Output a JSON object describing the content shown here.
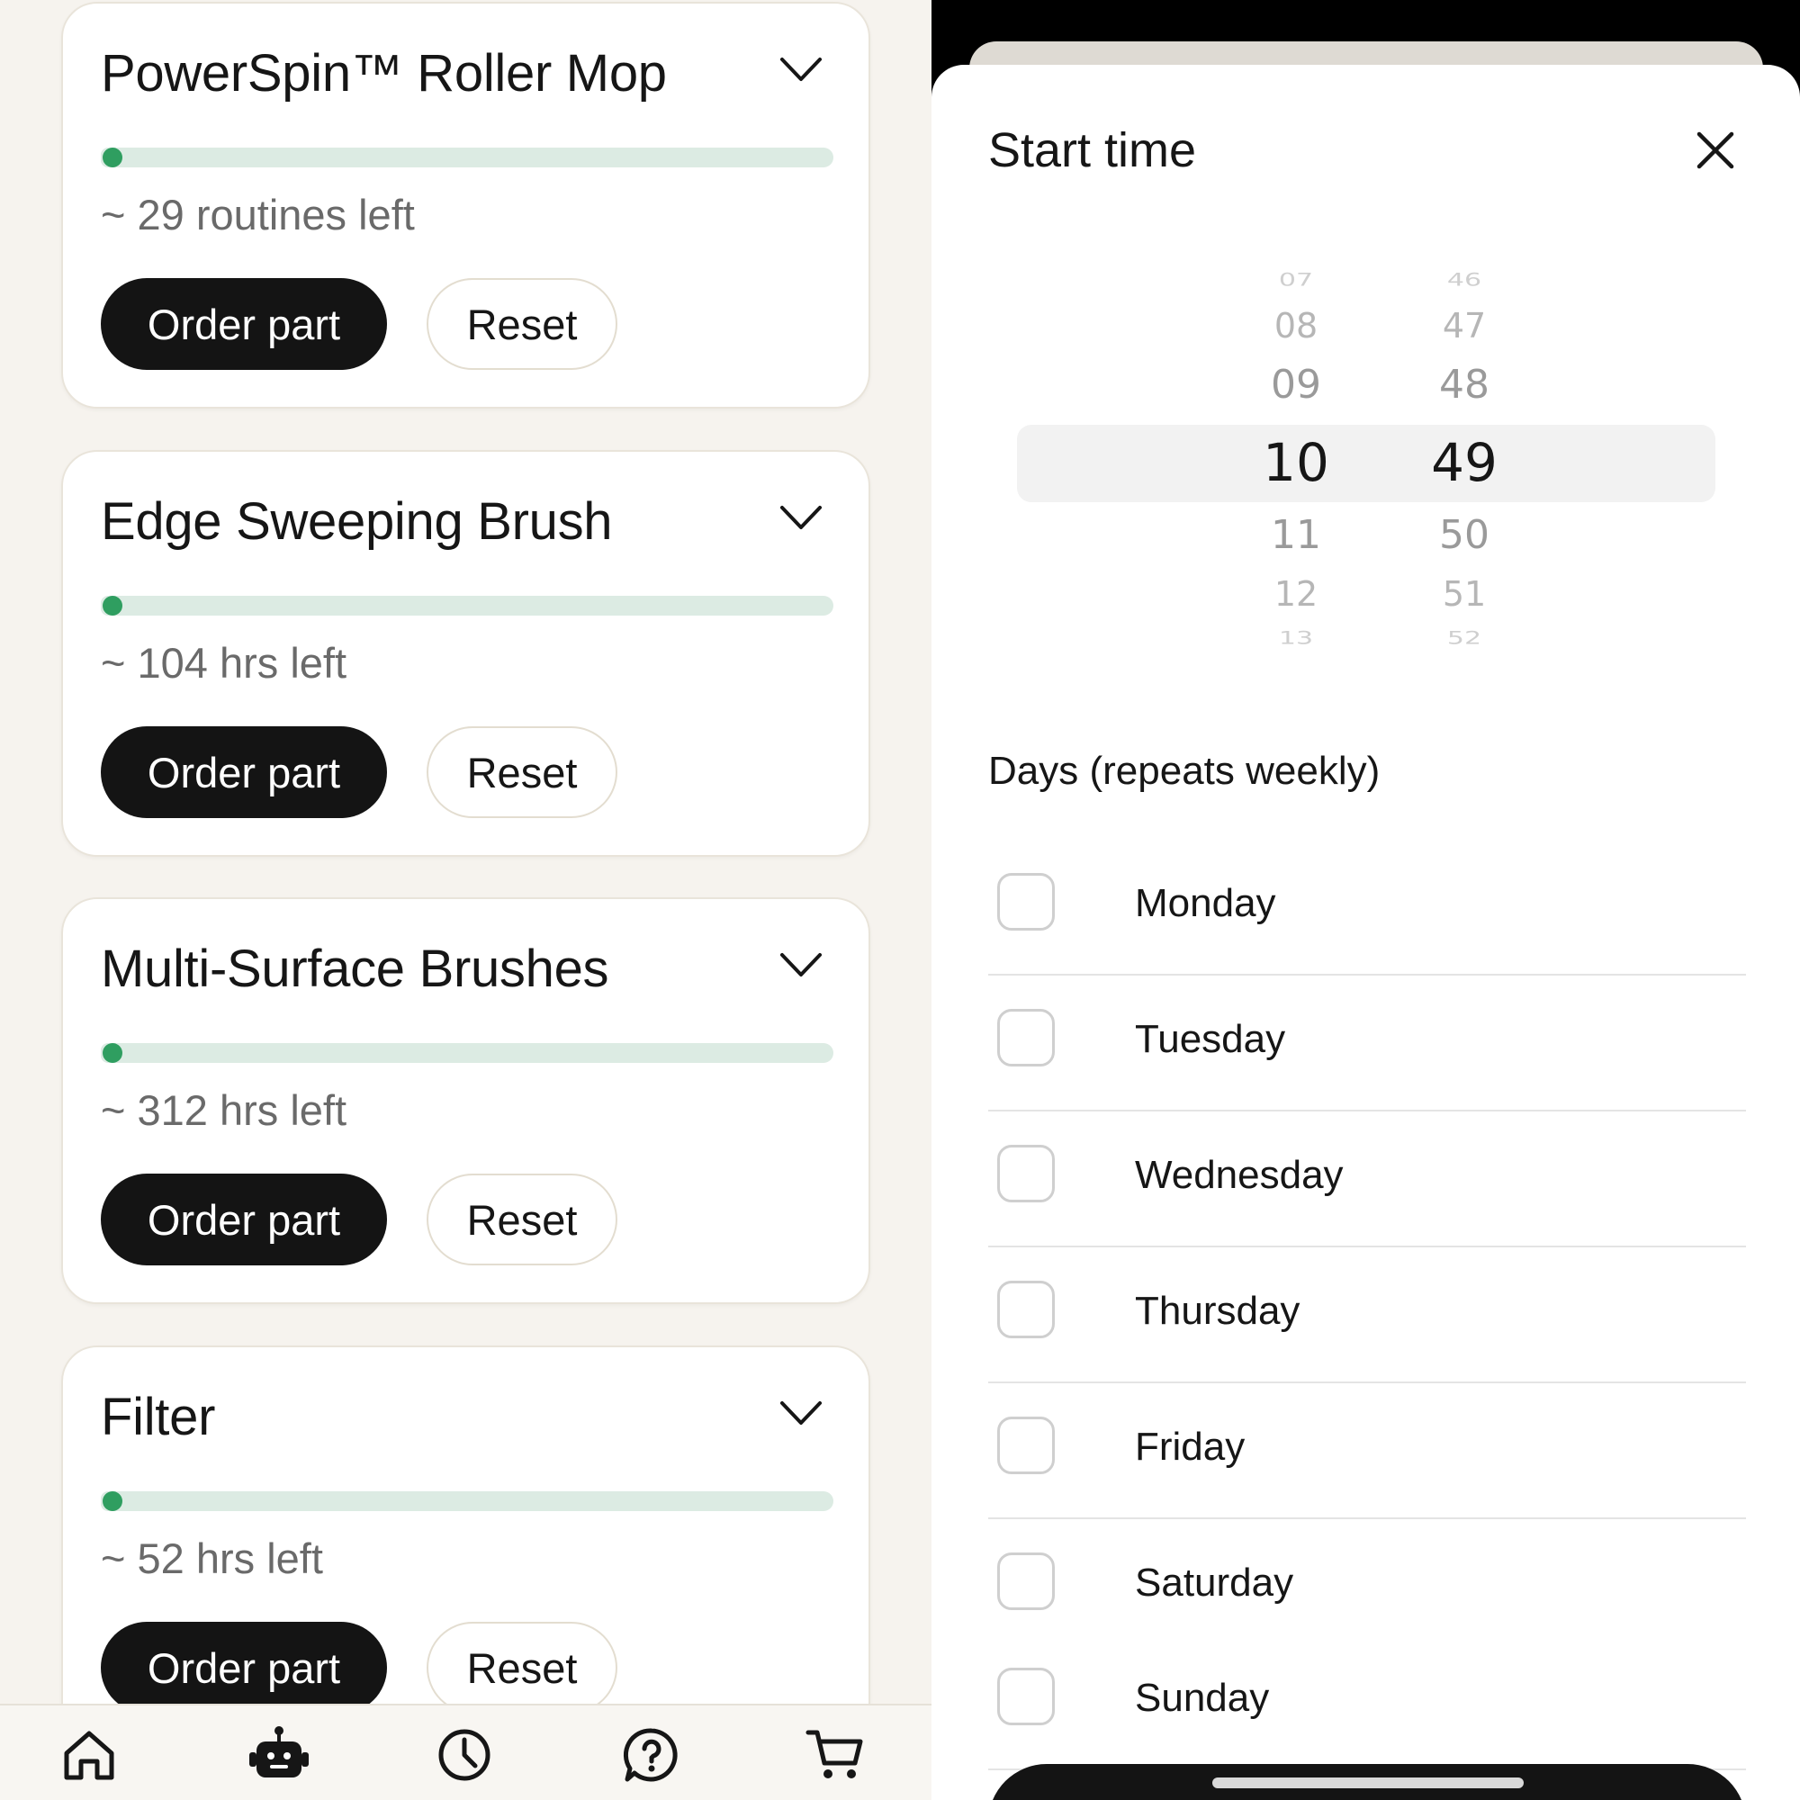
{
  "parts": [
    {
      "title": "PowerSpin™ Roller Mop",
      "remaining": "~ 29 routines left",
      "level": 0.02
    },
    {
      "title": "Edge Sweeping Brush",
      "remaining": "~ 104 hrs left",
      "level": 0.02
    },
    {
      "title": "Multi-Surface Brushes",
      "remaining": "~ 312 hrs left",
      "level": 0.02
    },
    {
      "title": "Filter",
      "remaining": "~ 52 hrs left",
      "level": 0.02
    }
  ],
  "buttons": {
    "order": "Order part",
    "reset": "Reset"
  },
  "tabbar": {
    "icons": [
      "home-icon",
      "robot-icon",
      "clock-icon",
      "help-icon",
      "cart-icon"
    ]
  },
  "sheet": {
    "title": "Start time",
    "picker": {
      "hours": [
        "07",
        "08",
        "09",
        "10",
        "11",
        "12",
        "13"
      ],
      "minutes": [
        "46",
        "47",
        "48",
        "49",
        "50",
        "51",
        "52"
      ],
      "selected_hour": "10",
      "selected_minute": "49"
    },
    "days_label": "Days (repeats weekly)",
    "days": [
      "Monday",
      "Tuesday",
      "Wednesday",
      "Thursday",
      "Friday",
      "Saturday",
      "Sunday"
    ]
  },
  "colors": {
    "progress_track": "#dcebe3",
    "progress_dot": "#2f9e60",
    "primary_button": "#141414",
    "background": "#f6f3ee"
  }
}
